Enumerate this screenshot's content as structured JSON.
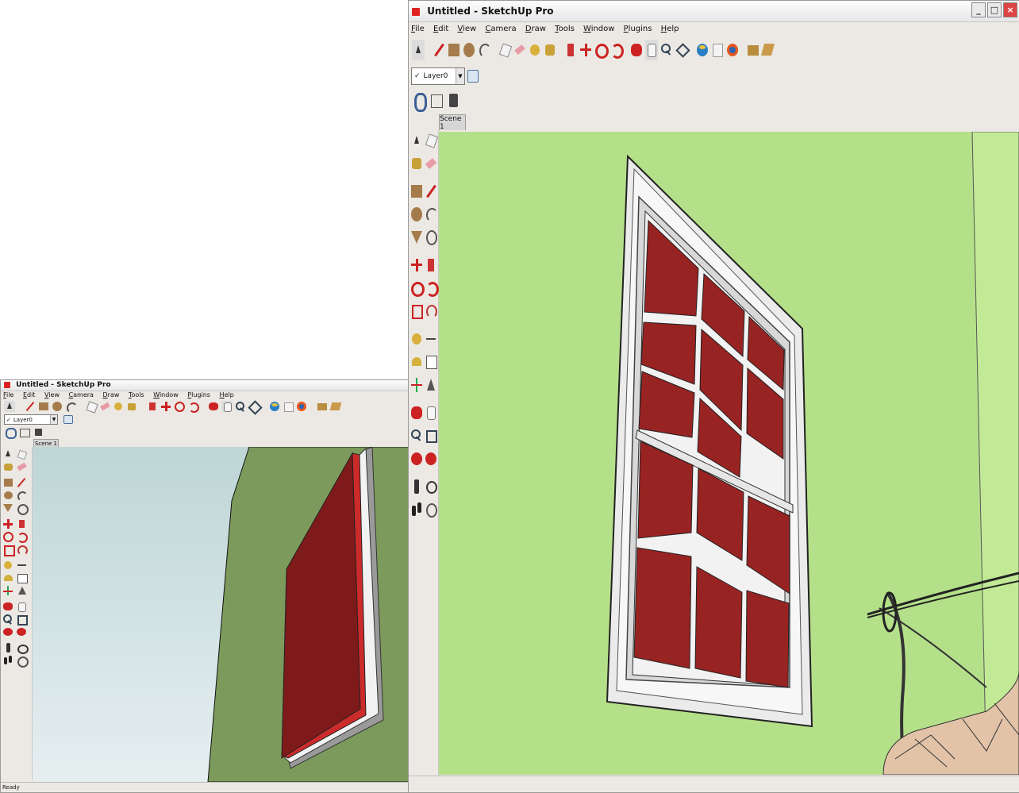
{
  "small_window": {
    "title": "Untitled - SketchUp Pro",
    "menu": [
      "File",
      "Edit",
      "View",
      "Camera",
      "Draw",
      "Tools",
      "Window",
      "Plugins",
      "Help"
    ],
    "layer_value": "Layer0",
    "scene_tab": "Scene 1",
    "status_text": "Ready",
    "colors": {
      "sky": "#c4dadb",
      "wall": "#7c9a5c",
      "panel": "#7e1a1a"
    }
  },
  "large_window": {
    "title": "Untitled - SketchUp Pro",
    "menu": [
      "File",
      "Edit",
      "View",
      "Camera",
      "Draw",
      "Tools",
      "Window",
      "Plugins",
      "Help"
    ],
    "layer_value": "Layer0",
    "scene_tab": "Scene 1",
    "colors": {
      "wall": "#b5e08a",
      "pane": "#982323",
      "frame": "#e8e8e8"
    }
  },
  "toolbar_icons": [
    "select-icon",
    "pencil-icon",
    "rectangle-icon",
    "circle-icon",
    "arc-icon",
    "make-component-icon",
    "eraser-icon",
    "paint-bucket-icon",
    "push-pull-icon",
    "move-icon",
    "rotate-icon",
    "offset-icon",
    "orbit-icon",
    "pan-icon",
    "zoom-icon",
    "zoom-extents-icon",
    "get-models-icon",
    "share-model-icon",
    "google-earth-icon",
    "component-icon",
    "warehouse-icon"
  ]
}
